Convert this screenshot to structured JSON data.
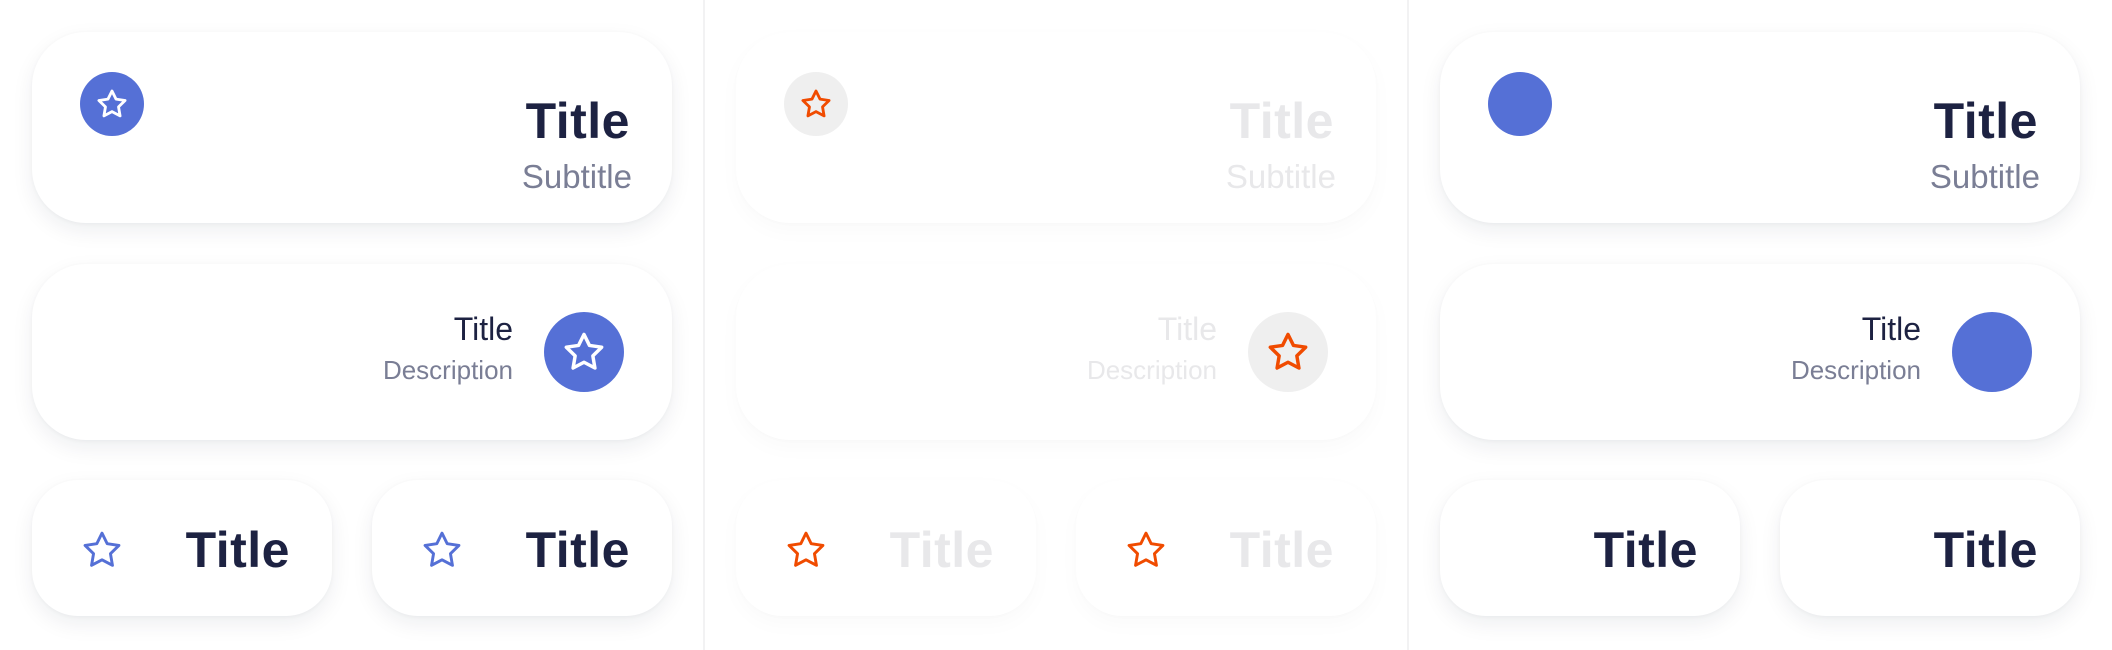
{
  "colors": {
    "accent": "#5570d6",
    "title": "#1d2242",
    "muted": "#7a7e95",
    "disabled_text": "#e8e8ea",
    "disabled_icon_bg": "#efefef",
    "orange_icon": "#f04b00",
    "panel_bg": "#ffffff"
  },
  "panels": [
    {
      "name": "enabled-with-icons",
      "big_card": {
        "title": "Title",
        "subtitle": "Subtitle",
        "icon": "star-icon"
      },
      "mid_card": {
        "title": "Title",
        "description": "Description",
        "icon": "star-icon"
      },
      "small_cards": [
        {
          "title": "Title",
          "icon": "star-icon"
        },
        {
          "title": "Title",
          "icon": "star-icon"
        }
      ]
    },
    {
      "name": "disabled",
      "big_card": {
        "title": "Title",
        "subtitle": "Subtitle",
        "icon": "star-icon"
      },
      "mid_card": {
        "title": "Title",
        "description": "Description",
        "icon": "star-icon"
      },
      "small_cards": [
        {
          "title": "Title",
          "icon": "star-icon"
        },
        {
          "title": "Title",
          "icon": "star-icon"
        }
      ]
    },
    {
      "name": "enabled-no-icons",
      "big_card": {
        "title": "Title",
        "subtitle": "Subtitle",
        "icon": "circle-icon"
      },
      "mid_card": {
        "title": "Title",
        "description": "Description",
        "icon": "circle-icon"
      },
      "small_cards": [
        {
          "title": "Title"
        },
        {
          "title": "Title"
        }
      ]
    }
  ]
}
